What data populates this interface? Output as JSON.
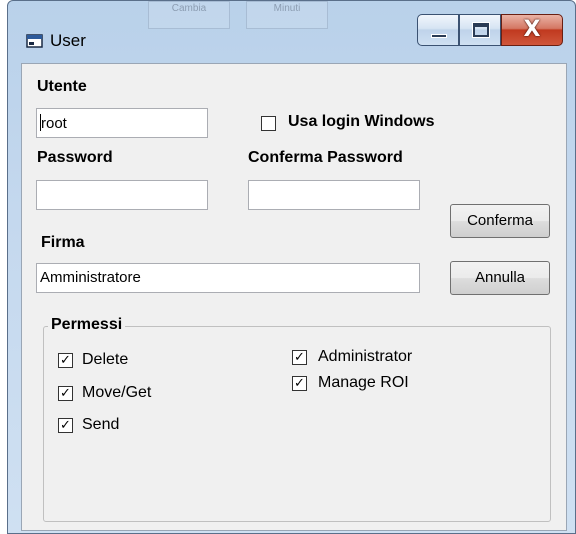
{
  "window": {
    "title": "User",
    "background_ghost": [
      "Cambia",
      "Minuti"
    ]
  },
  "form": {
    "user_label": "Utente",
    "user_value": "root",
    "windows_login_label": "Usa login Windows",
    "windows_login_checked": false,
    "password_label": "Password",
    "password_value": "",
    "confirm_password_label": "Conferma Password",
    "confirm_password_value": "",
    "signature_label": "Firma",
    "signature_value": "Amministratore"
  },
  "buttons": {
    "confirm": "Conferma",
    "cancel": "Annulla"
  },
  "permissions": {
    "legend": "Permessi",
    "items": [
      {
        "label": "Delete",
        "checked": true
      },
      {
        "label": "Move/Get",
        "checked": true
      },
      {
        "label": "Send",
        "checked": true
      },
      {
        "label": "Administrator",
        "checked": true
      },
      {
        "label": "Manage ROI",
        "checked": true
      }
    ]
  },
  "colors": {
    "titlebar": "#c4d8ee",
    "client": "#f0f0f0",
    "close_button": "#c0391f"
  }
}
